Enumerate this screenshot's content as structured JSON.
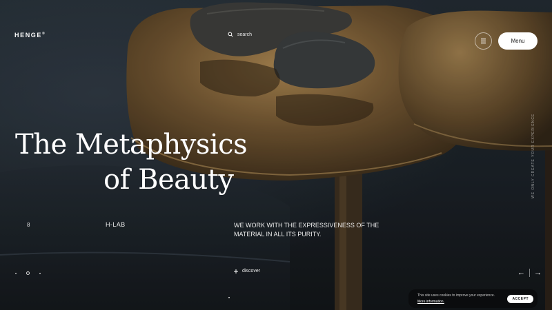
{
  "header": {
    "logo": "HENGE",
    "logo_mark": "®",
    "search_label": "search",
    "search_icon": "search-icon",
    "grid_icon": "grid-icon",
    "menu_label": "Menu"
  },
  "hero": {
    "title_line1": "The Metaphysics",
    "title_line2": "of Beauty",
    "vertical_caption": "WE ONLY CREATE YOUR EXPERIENCE",
    "slide_number": "8",
    "project_name": "H-LAB",
    "tagline": "WE WORK WITH THE EXPRESSIVENESS OF THE MATERIAL IN ALL ITS PURITY.",
    "discover_label": "discover",
    "prev_arrow": "←",
    "next_arrow": "→"
  },
  "cookie": {
    "text": "This site uses cookies to improve your experience.",
    "link": "More information.",
    "accept_label": "ACCEPT"
  },
  "colors": {
    "background": "#1b2127",
    "bronze": "#8a6a3c",
    "menu_button": "#ffffff",
    "cookie_bg": "#0b0c0e"
  }
}
